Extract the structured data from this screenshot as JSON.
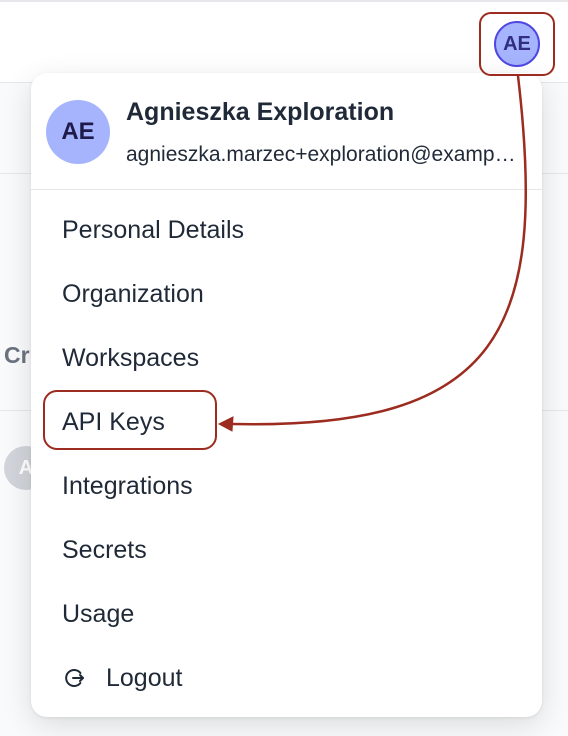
{
  "header": {
    "avatar_initials": "AE"
  },
  "background": {
    "partial_text": "Cr",
    "partial_avatar": "A"
  },
  "menu": {
    "user": {
      "initials": "AE",
      "name": "Agnieszka Exploration",
      "email": "agnieszka.marzec+exploration@example.com"
    },
    "items": [
      {
        "label": "Personal Details"
      },
      {
        "label": "Organization"
      },
      {
        "label": "Workspaces"
      },
      {
        "label": "API Keys"
      },
      {
        "label": "Integrations"
      },
      {
        "label": "Secrets"
      },
      {
        "label": "Usage"
      }
    ],
    "logout_label": "Logout",
    "logout_icon": "logout-icon"
  },
  "colors": {
    "annotation": "#9b2c1f",
    "avatar_bg": "#a5b4fc",
    "avatar_border": "#4f46e5"
  }
}
